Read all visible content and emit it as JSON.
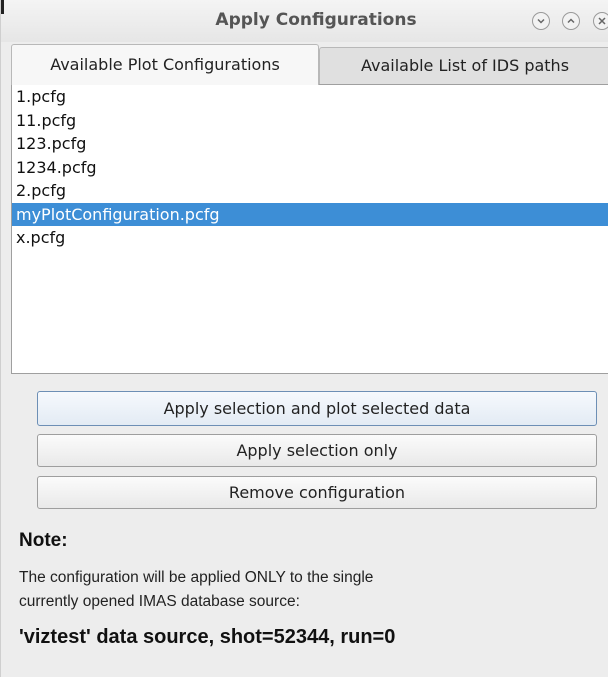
{
  "window": {
    "title": "Apply Configurations"
  },
  "tabs": [
    {
      "label": "Available Plot Configurations",
      "active": true
    },
    {
      "label": "Available List of IDS paths",
      "active": false
    }
  ],
  "configurations": {
    "items": [
      {
        "label": "1.pcfg",
        "selected": false
      },
      {
        "label": "11.pcfg",
        "selected": false
      },
      {
        "label": "123.pcfg",
        "selected": false
      },
      {
        "label": "1234.pcfg",
        "selected": false
      },
      {
        "label": "2.pcfg",
        "selected": false
      },
      {
        "label": "myPlotConfiguration.pcfg",
        "selected": true
      },
      {
        "label": "x.pcfg",
        "selected": false
      }
    ]
  },
  "buttons": {
    "apply_and_plot": "Apply selection and plot selected data",
    "apply_only": "Apply selection only",
    "remove": "Remove configuration"
  },
  "note": {
    "title": "Note:",
    "line1": "The configuration will be applied ONLY to the single",
    "line2": "currently opened IMAS database source:",
    "source": "'viztest' data source, shot=52344, run=0"
  },
  "colors": {
    "selection": "#3d8ed6",
    "window_bg": "#ededed"
  },
  "icons": [
    "minimize-icon",
    "maximize-icon",
    "close-icon"
  ]
}
